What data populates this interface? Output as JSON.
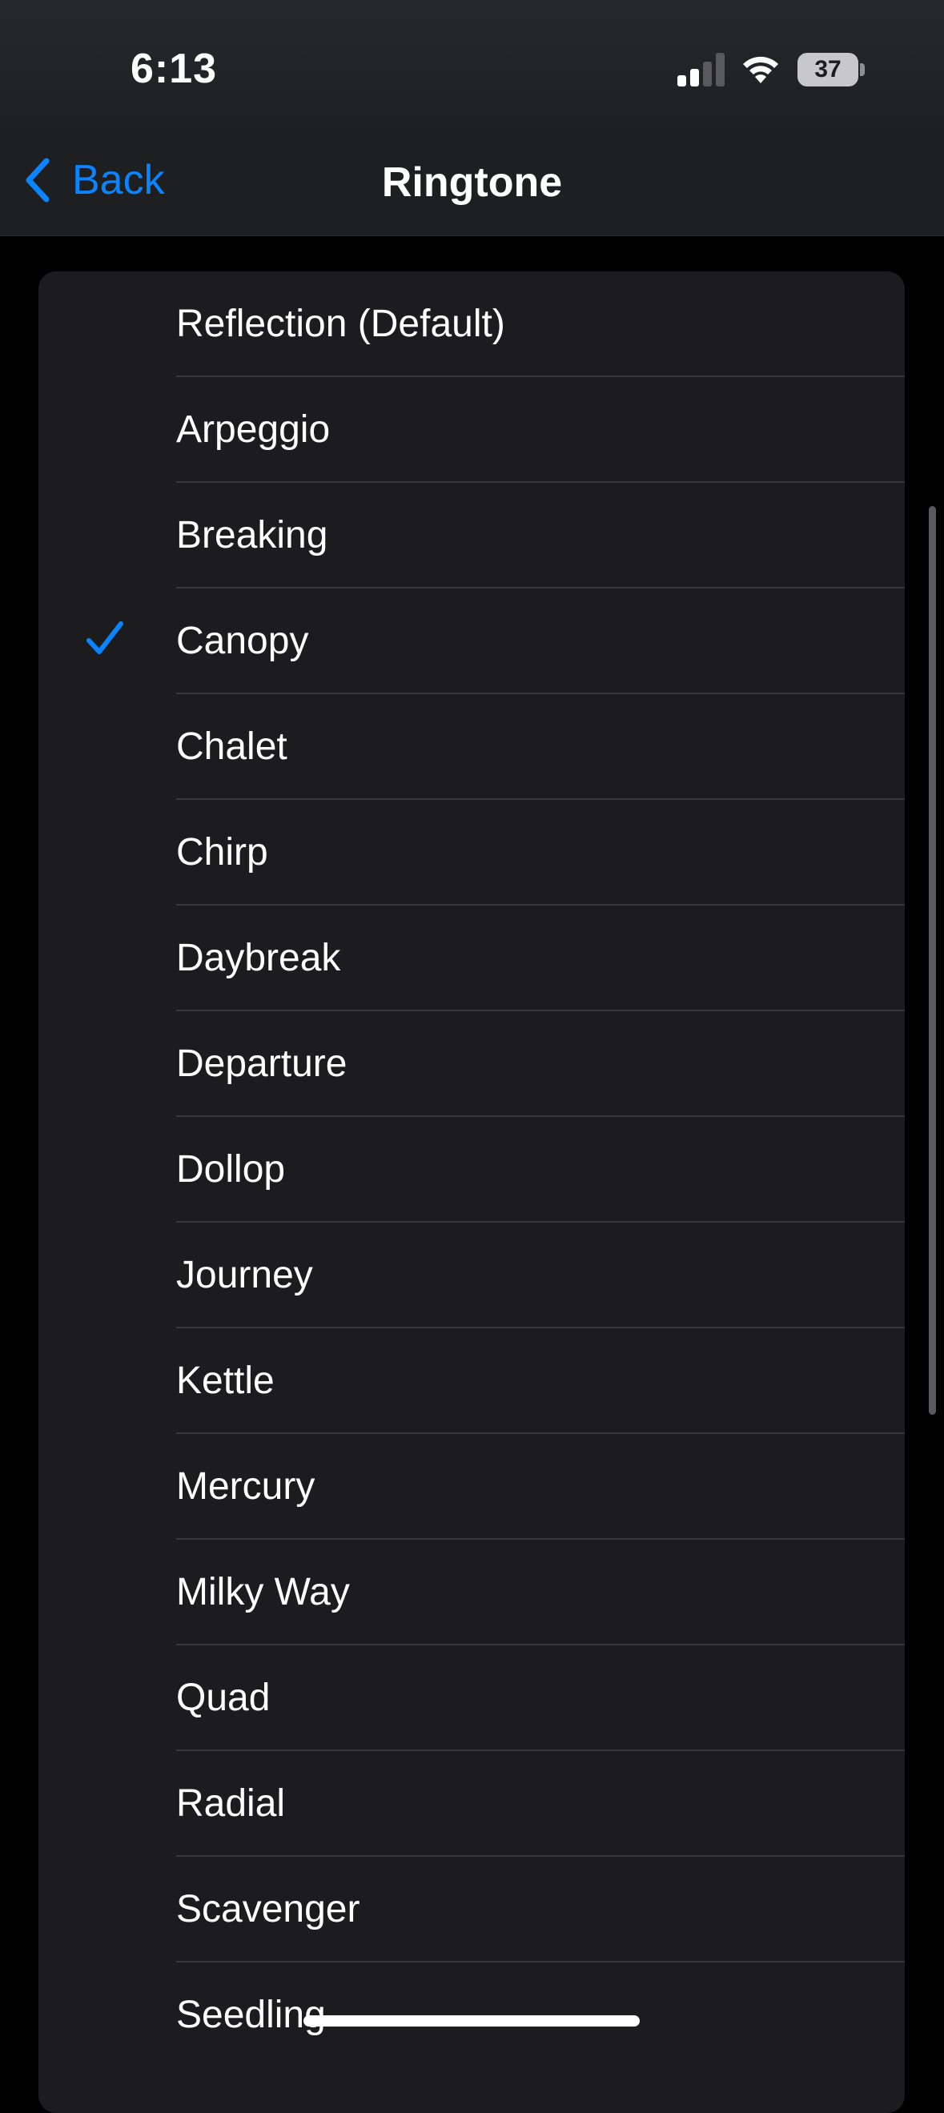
{
  "status_bar": {
    "time": "6:13",
    "battery_level": "37",
    "signal_icon": "cellular-signal-icon",
    "wifi_icon": "wifi-icon",
    "battery_icon": "battery-icon"
  },
  "nav": {
    "back_label": "Back",
    "back_icon": "chevron-left-icon",
    "title": "Ringtone"
  },
  "ringtones": [
    {
      "label": "Reflection (Default)",
      "selected": false
    },
    {
      "label": "Arpeggio",
      "selected": false
    },
    {
      "label": "Breaking",
      "selected": false
    },
    {
      "label": "Canopy",
      "selected": true
    },
    {
      "label": "Chalet",
      "selected": false
    },
    {
      "label": "Chirp",
      "selected": false
    },
    {
      "label": "Daybreak",
      "selected": false
    },
    {
      "label": "Departure",
      "selected": false
    },
    {
      "label": "Dollop",
      "selected": false
    },
    {
      "label": "Journey",
      "selected": false
    },
    {
      "label": "Kettle",
      "selected": false
    },
    {
      "label": "Mercury",
      "selected": false
    },
    {
      "label": "Milky Way",
      "selected": false
    },
    {
      "label": "Quad",
      "selected": false
    },
    {
      "label": "Radial",
      "selected": false
    },
    {
      "label": "Scavenger",
      "selected": false
    },
    {
      "label": "Seedling",
      "selected": false
    }
  ],
  "colors": {
    "accent": "#0a84ff",
    "background": "#000000",
    "card": "#1c1c1e",
    "separator": "#38383a",
    "text": "#ffffff"
  }
}
